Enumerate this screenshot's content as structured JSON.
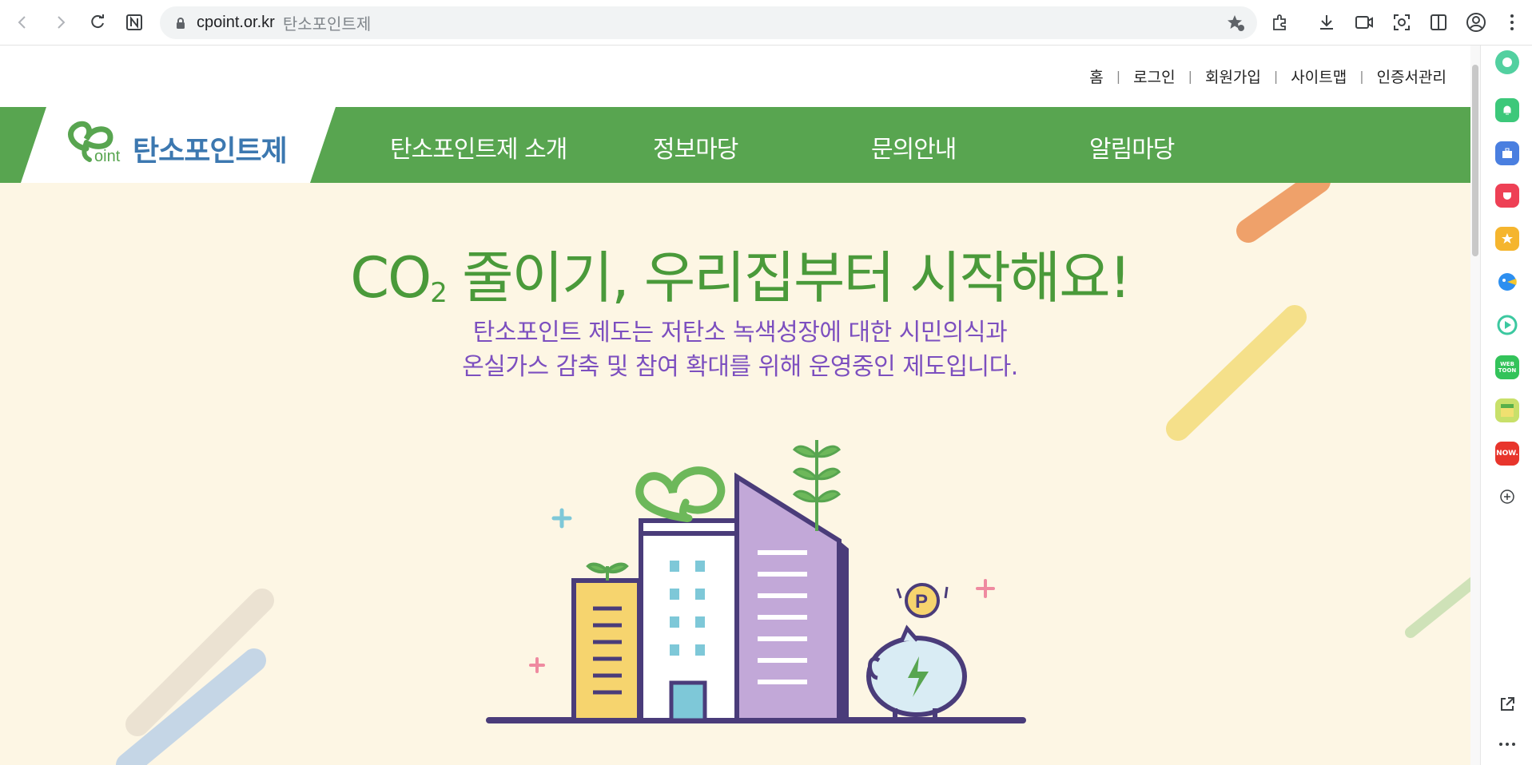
{
  "browser": {
    "url": "cpoint.or.kr",
    "page_title": "탄소포인트제"
  },
  "utility_links": [
    "홈",
    "로그인",
    "회원가입",
    "사이트맵",
    "인증서관리"
  ],
  "logo": {
    "prefix": "oint",
    "name": "탄소포인트제"
  },
  "main_menu": [
    "탄소포인트제 소개",
    "정보마당",
    "문의안내",
    "알림마당"
  ],
  "hero": {
    "title_co": "CO",
    "title_sub": "2",
    "title_rest": " 줄이기, 우리집부터 시작해요!",
    "subtitle_line1": "탄소포인트 제도는 저탄소 녹색성장에 대한 시민의식과",
    "subtitle_line2": "온실가스 감축 및 참여 확대를 위해 운영중인 제도입니다.",
    "coin_letter": "P"
  },
  "sidebar": {
    "webtoon_label": "WEB TOON",
    "now_label": "NOW."
  },
  "colors": {
    "nav_green": "#58a550",
    "hero_bg": "#fdf6e4",
    "title_green": "#4a9a3a",
    "subtitle_purple": "#7c4fbf"
  }
}
